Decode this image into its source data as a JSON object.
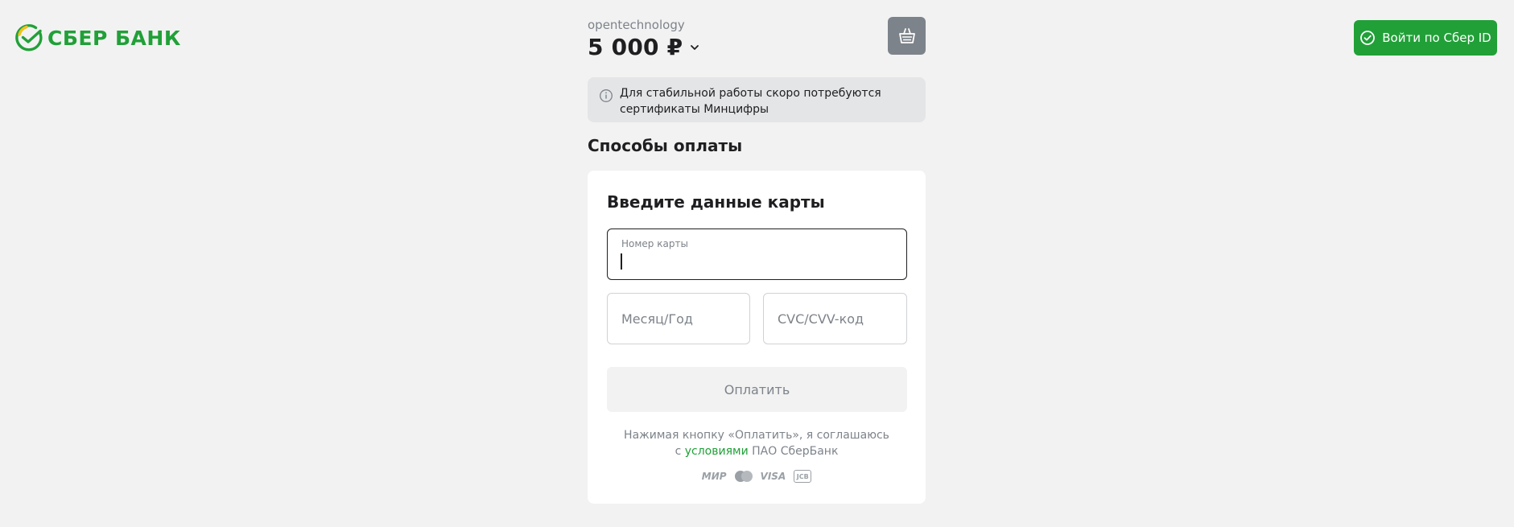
{
  "logo": {
    "text": "СБЕР БАНК"
  },
  "header": {
    "sber_id_label": "Войти по Сбер ID"
  },
  "order": {
    "merchant": "opentechnology",
    "amount": "5 000 ₽"
  },
  "notice": {
    "text": "Для стабильной работы скоро потребуются сертификаты Минцифры"
  },
  "payment_methods": {
    "title": "Способы оплаты"
  },
  "card_form": {
    "title": "Введите данные карты",
    "card_number_label": "Номер карты",
    "card_number_value": "",
    "expiry_placeholder": "Месяц/Год",
    "cvc_placeholder": "CVC/CVV-код",
    "pay_label": "Оплатить",
    "terms_prefix": "Нажимая кнопку «Оплатить», я соглашаюсь",
    "terms_c": "с",
    "terms_link": "условиями",
    "terms_suffix": "ПАО СберБанк"
  },
  "pay_systems": {
    "mir": "МИР",
    "mastercard": "mastercard-icon",
    "visa": "VISA",
    "jcb": "JCB"
  },
  "colors": {
    "brand": "#21a038",
    "background": "#f2f2f2",
    "muted": "#7d838a"
  }
}
